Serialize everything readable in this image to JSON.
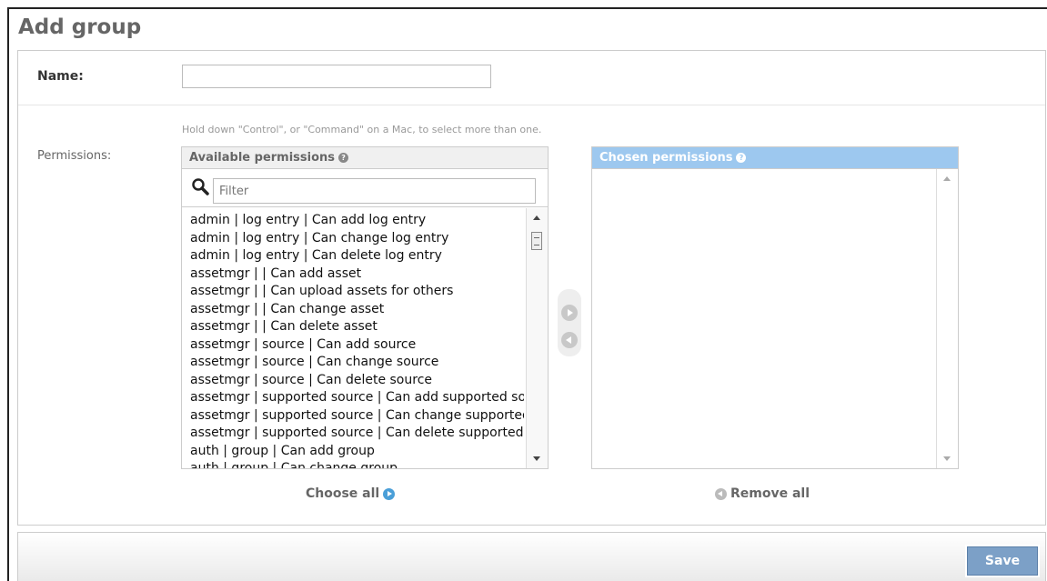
{
  "page_title": "Add group",
  "name_field": {
    "label": "Name:",
    "value": ""
  },
  "permissions": {
    "label": "Permissions:",
    "help_text": "Hold down \"Control\", or \"Command\" on a Mac, to select more than one.",
    "available": {
      "title": "Available permissions",
      "help_icon": "question-icon",
      "filter_placeholder": "Filter",
      "search_icon": "search-icon",
      "items": [
        "admin | log entry | Can add log entry",
        "admin | log entry | Can change log entry",
        "admin | log entry | Can delete log entry",
        "assetmgr | | Can add asset",
        "assetmgr | | Can upload assets for others",
        "assetmgr | | Can change asset",
        "assetmgr | | Can delete asset",
        "assetmgr | source | Can add source",
        "assetmgr | source | Can change source",
        "assetmgr | source | Can delete source",
        "assetmgr | supported source | Can add supported source",
        "assetmgr | supported source | Can change supported source",
        "assetmgr | supported source | Can delete supported source",
        "auth | group | Can add group",
        "auth | group | Can change group"
      ]
    },
    "chosen": {
      "title": "Chosen permissions",
      "help_icon": "question-icon",
      "items": []
    },
    "choose_all_label": "Choose all",
    "remove_all_label": "Remove all"
  },
  "submit": {
    "save_label": "Save"
  },
  "colors": {
    "chosen_header": "#9dc8ef",
    "save_button": "#7ca0c7",
    "choose_all_icon": "#4a9fd8"
  }
}
